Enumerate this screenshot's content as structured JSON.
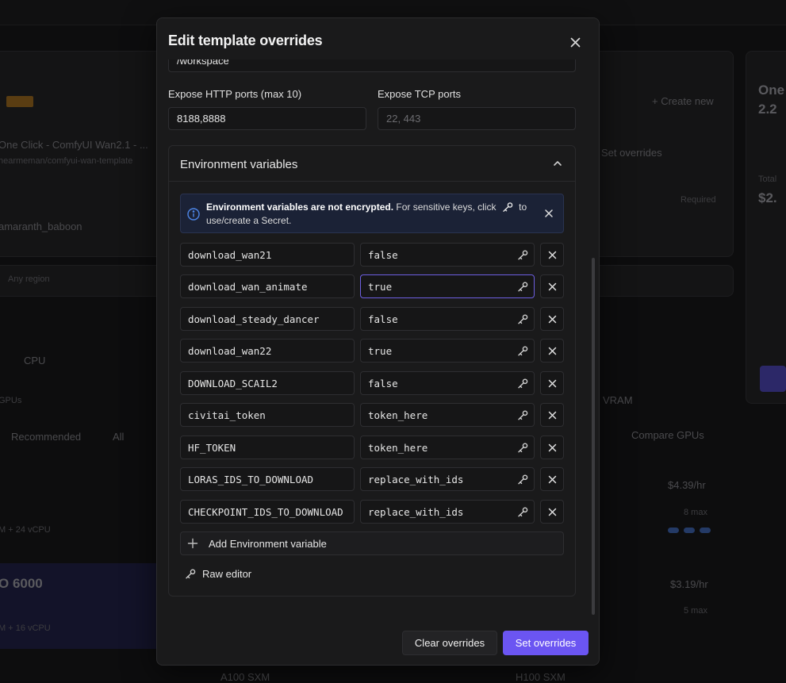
{
  "modal": {
    "title": "Edit template overrides",
    "volume_path_value": "/workspace",
    "http_ports_label": "Expose HTTP ports (max 10)",
    "http_ports_value": "8188,8888",
    "tcp_ports_label": "Expose TCP ports",
    "tcp_ports_placeholder": "22, 443"
  },
  "env": {
    "title": "Environment variables",
    "notice_bold": "Environment variables are not encrypted.",
    "notice_text1": " For sensitive keys, click ",
    "notice_text2": " to use/create a Secret.",
    "add_label": "Add Environment variable",
    "raw_editor_label": "Raw editor",
    "variables": [
      {
        "key": "download_wan21",
        "value": "false"
      },
      {
        "key": "download_wan_animate",
        "value": "true"
      },
      {
        "key": "download_steady_dancer",
        "value": "false"
      },
      {
        "key": "download_wan22",
        "value": "true"
      },
      {
        "key": "DOWNLOAD_SCAIL2",
        "value": "false"
      },
      {
        "key": "civitai_token",
        "value": "token_here"
      },
      {
        "key": "HF_TOKEN",
        "value": "token_here"
      },
      {
        "key": "LORAS_IDS_TO_DOWNLOAD",
        "value": "replace_with_ids"
      },
      {
        "key": "CHECKPOINT_IDS_TO_DOWNLOAD",
        "value": "replace_with_ids"
      }
    ]
  },
  "footer": {
    "clear_label": "Clear overrides",
    "set_label": "Set overrides"
  },
  "background": {
    "create_new": "+ Create new",
    "set_overrides": "Set overrides",
    "template_name": "One Click - ComfyUI Wan2.1 - ...",
    "template_sub": "hearmeman/comfyui-wan-template",
    "pod_name": "amaranth_baboon",
    "required": "Required",
    "region": "Any region",
    "cpu": "CPU",
    "gpus": "GPUs",
    "recommended": "Recommended",
    "all": "All",
    "vram": "VRAM",
    "compare": "Compare GPUs",
    "price1": "$4.39/hr",
    "price2": "$3.19/hr",
    "max1": "8 max",
    "max2": "5 max",
    "gpu_name": "O 6000",
    "spec1": "M + 24 vCPU",
    "spec2": "M + 16 vCPU",
    "gpu_a": "A100 SXM",
    "gpu_h": "H100 SXM",
    "side_title": "One",
    "side_version": "2.2",
    "side_price": "$2.",
    "side_total": "Total"
  },
  "colors": {
    "accent": "#6b55f2",
    "focus_border": "#6d5fe0",
    "notice_bg": "#1b2236",
    "info_icon": "#4d86e8"
  }
}
